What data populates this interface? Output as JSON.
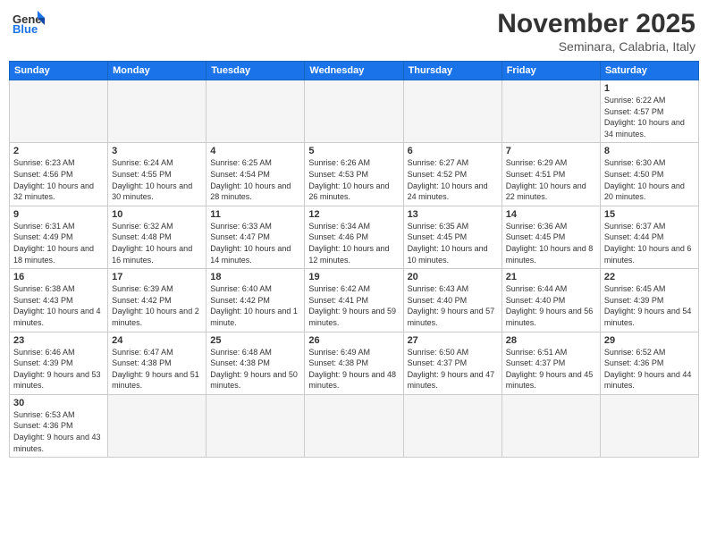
{
  "logo": {
    "text_general": "General",
    "text_blue": "Blue"
  },
  "header": {
    "month_title": "November 2025",
    "subtitle": "Seminara, Calabria, Italy"
  },
  "weekdays": [
    "Sunday",
    "Monday",
    "Tuesday",
    "Wednesday",
    "Thursday",
    "Friday",
    "Saturday"
  ],
  "weeks": [
    [
      {
        "day": "",
        "info": ""
      },
      {
        "day": "",
        "info": ""
      },
      {
        "day": "",
        "info": ""
      },
      {
        "day": "",
        "info": ""
      },
      {
        "day": "",
        "info": ""
      },
      {
        "day": "",
        "info": ""
      },
      {
        "day": "1",
        "info": "Sunrise: 6:22 AM\nSunset: 4:57 PM\nDaylight: 10 hours and 34 minutes."
      }
    ],
    [
      {
        "day": "2",
        "info": "Sunrise: 6:23 AM\nSunset: 4:56 PM\nDaylight: 10 hours and 32 minutes."
      },
      {
        "day": "3",
        "info": "Sunrise: 6:24 AM\nSunset: 4:55 PM\nDaylight: 10 hours and 30 minutes."
      },
      {
        "day": "4",
        "info": "Sunrise: 6:25 AM\nSunset: 4:54 PM\nDaylight: 10 hours and 28 minutes."
      },
      {
        "day": "5",
        "info": "Sunrise: 6:26 AM\nSunset: 4:53 PM\nDaylight: 10 hours and 26 minutes."
      },
      {
        "day": "6",
        "info": "Sunrise: 6:27 AM\nSunset: 4:52 PM\nDaylight: 10 hours and 24 minutes."
      },
      {
        "day": "7",
        "info": "Sunrise: 6:29 AM\nSunset: 4:51 PM\nDaylight: 10 hours and 22 minutes."
      },
      {
        "day": "8",
        "info": "Sunrise: 6:30 AM\nSunset: 4:50 PM\nDaylight: 10 hours and 20 minutes."
      }
    ],
    [
      {
        "day": "9",
        "info": "Sunrise: 6:31 AM\nSunset: 4:49 PM\nDaylight: 10 hours and 18 minutes."
      },
      {
        "day": "10",
        "info": "Sunrise: 6:32 AM\nSunset: 4:48 PM\nDaylight: 10 hours and 16 minutes."
      },
      {
        "day": "11",
        "info": "Sunrise: 6:33 AM\nSunset: 4:47 PM\nDaylight: 10 hours and 14 minutes."
      },
      {
        "day": "12",
        "info": "Sunrise: 6:34 AM\nSunset: 4:46 PM\nDaylight: 10 hours and 12 minutes."
      },
      {
        "day": "13",
        "info": "Sunrise: 6:35 AM\nSunset: 4:45 PM\nDaylight: 10 hours and 10 minutes."
      },
      {
        "day": "14",
        "info": "Sunrise: 6:36 AM\nSunset: 4:45 PM\nDaylight: 10 hours and 8 minutes."
      },
      {
        "day": "15",
        "info": "Sunrise: 6:37 AM\nSunset: 4:44 PM\nDaylight: 10 hours and 6 minutes."
      }
    ],
    [
      {
        "day": "16",
        "info": "Sunrise: 6:38 AM\nSunset: 4:43 PM\nDaylight: 10 hours and 4 minutes."
      },
      {
        "day": "17",
        "info": "Sunrise: 6:39 AM\nSunset: 4:42 PM\nDaylight: 10 hours and 2 minutes."
      },
      {
        "day": "18",
        "info": "Sunrise: 6:40 AM\nSunset: 4:42 PM\nDaylight: 10 hours and 1 minute."
      },
      {
        "day": "19",
        "info": "Sunrise: 6:42 AM\nSunset: 4:41 PM\nDaylight: 9 hours and 59 minutes."
      },
      {
        "day": "20",
        "info": "Sunrise: 6:43 AM\nSunset: 4:40 PM\nDaylight: 9 hours and 57 minutes."
      },
      {
        "day": "21",
        "info": "Sunrise: 6:44 AM\nSunset: 4:40 PM\nDaylight: 9 hours and 56 minutes."
      },
      {
        "day": "22",
        "info": "Sunrise: 6:45 AM\nSunset: 4:39 PM\nDaylight: 9 hours and 54 minutes."
      }
    ],
    [
      {
        "day": "23",
        "info": "Sunrise: 6:46 AM\nSunset: 4:39 PM\nDaylight: 9 hours and 53 minutes."
      },
      {
        "day": "24",
        "info": "Sunrise: 6:47 AM\nSunset: 4:38 PM\nDaylight: 9 hours and 51 minutes."
      },
      {
        "day": "25",
        "info": "Sunrise: 6:48 AM\nSunset: 4:38 PM\nDaylight: 9 hours and 50 minutes."
      },
      {
        "day": "26",
        "info": "Sunrise: 6:49 AM\nSunset: 4:38 PM\nDaylight: 9 hours and 48 minutes."
      },
      {
        "day": "27",
        "info": "Sunrise: 6:50 AM\nSunset: 4:37 PM\nDaylight: 9 hours and 47 minutes."
      },
      {
        "day": "28",
        "info": "Sunrise: 6:51 AM\nSunset: 4:37 PM\nDaylight: 9 hours and 45 minutes."
      },
      {
        "day": "29",
        "info": "Sunrise: 6:52 AM\nSunset: 4:36 PM\nDaylight: 9 hours and 44 minutes."
      }
    ],
    [
      {
        "day": "30",
        "info": "Sunrise: 6:53 AM\nSunset: 4:36 PM\nDaylight: 9 hours and 43 minutes."
      },
      {
        "day": "",
        "info": ""
      },
      {
        "day": "",
        "info": ""
      },
      {
        "day": "",
        "info": ""
      },
      {
        "day": "",
        "info": ""
      },
      {
        "day": "",
        "info": ""
      },
      {
        "day": "",
        "info": ""
      }
    ]
  ]
}
